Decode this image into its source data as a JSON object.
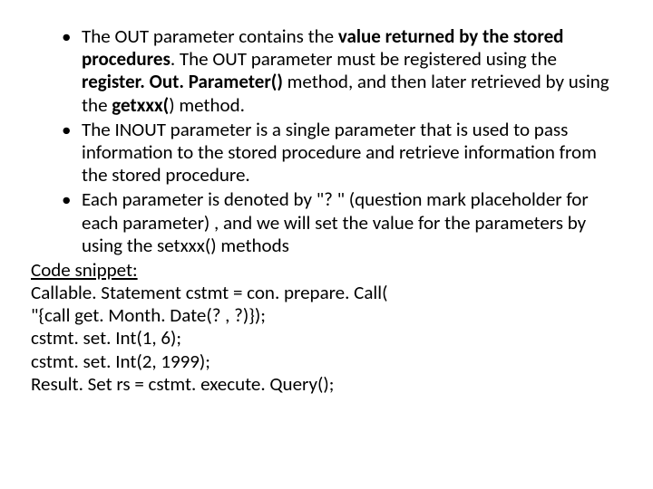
{
  "bullets": {
    "b1": {
      "t1": "The OUT parameter contains the ",
      "t2": "value returned by the stored procedures",
      "t3": ". The OUT parameter must be registered using the ",
      "t4": "register. Out. Parameter()",
      "t5": " method, and then later retrieved by using the ",
      "t6": "getxxx(",
      "t7": ") method."
    },
    "b2": "The INOUT parameter is a single parameter that is used to pass information to the stored procedure and retrieve information from the stored procedure.",
    "b3": "Each parameter is denoted by \"? \" (question mark placeholder for each parameter) , and we will set the value for the parameters by using the setxxx() methods"
  },
  "code": {
    "heading": "Code snippet:",
    "l1": "Callable. Statement  cstmt = con. prepare. Call(",
    "l2": "\"{call get. Month. Date(? , ?)});",
    "l3": "cstmt. set. Int(1, 6);",
    "l4": "cstmt. set. Int(2, 1999);",
    "l5": "Result. Set  rs = cstmt. execute. Query();"
  }
}
